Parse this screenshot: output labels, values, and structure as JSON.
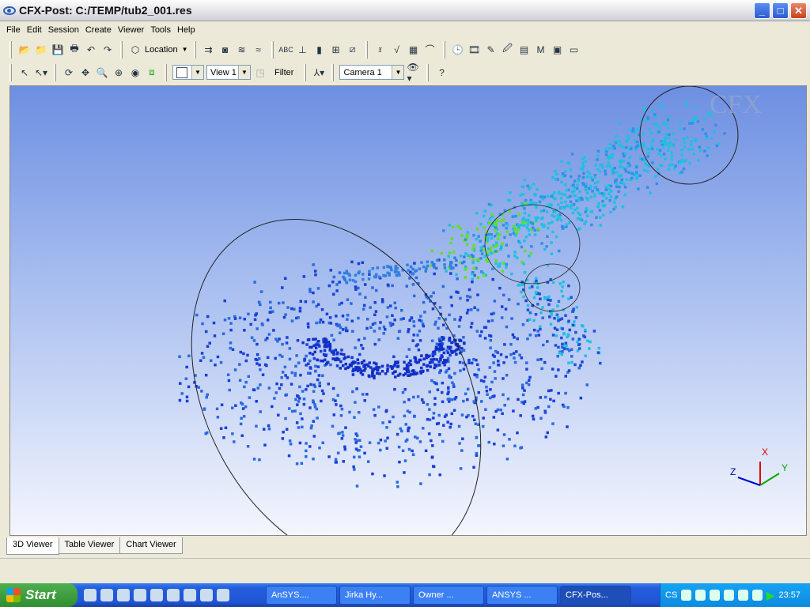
{
  "window": {
    "title": "CFX-Post: C:/TEMP/tub2_001.res",
    "buttons": [
      "_",
      "□",
      "✕"
    ]
  },
  "menu": [
    "File",
    "Edit",
    "Session",
    "Create",
    "Viewer",
    "Tools",
    "Help"
  ],
  "toolbar1": {
    "location_label": "Location"
  },
  "toolbar2": {
    "view_value": "View 1",
    "filter_label": "Filter",
    "camera_value": "Camera 1"
  },
  "viewer": {
    "logo": "CFX",
    "axes": {
      "x": "X",
      "y": "Y",
      "z": "Z"
    },
    "colors": {
      "low": "#1030d0",
      "mid": "#20c0e0",
      "high": "#60e020"
    }
  },
  "tabs": [
    {
      "label": "3D Viewer",
      "active": true
    },
    {
      "label": "Table Viewer"
    },
    {
      "label": "Chart Viewer"
    }
  ],
  "taskbar": {
    "start": "Start",
    "tasks": [
      {
        "label": "AnSYS...."
      },
      {
        "label": "Jirka Hy..."
      },
      {
        "label": "Owner ..."
      },
      {
        "label": "ANSYS ..."
      },
      {
        "label": "CFX-Pos...",
        "active": true
      }
    ],
    "tray_text": "CS",
    "clock": "23:57"
  }
}
